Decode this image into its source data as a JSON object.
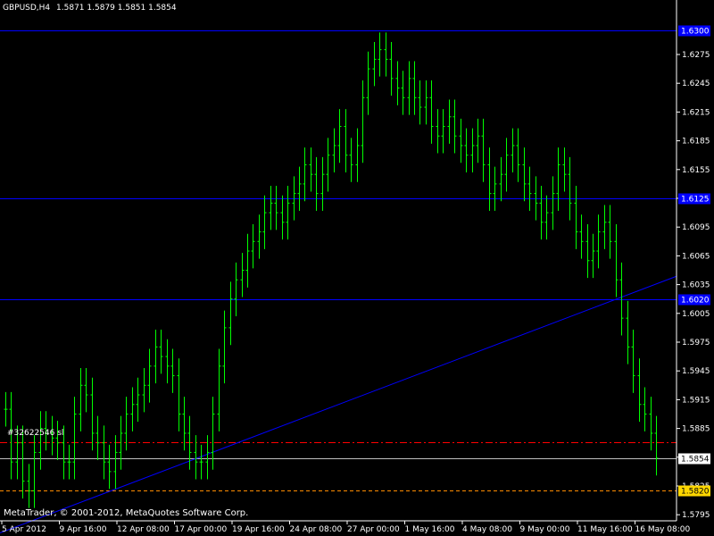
{
  "header": {
    "symbol_label": "GBPUSD,H4",
    "ohlc_label": "1.5871 1.5879 1.5851 1.5854"
  },
  "watermark": "MetaTrader, © 2001-2012, MetaQuotes Software Corp.",
  "order_label": "#32622546 sl",
  "colors": {
    "background": "#000000",
    "candle": "#00ff00",
    "hline": "#0000ff",
    "trendline": "#0000ff",
    "dashed_red": "#ff0000",
    "dashed_orange": "#ff8c00",
    "price_box_blue": "#0000ff",
    "price_box_current": "#ffffff",
    "price_box_orange": "#ffd700",
    "axis_text": "#ffffff"
  },
  "chart_data": {
    "type": "line",
    "symbol": "GBPUSD",
    "timeframe": "H4",
    "ylim": [
      1.579,
      1.632
    ],
    "y_ticks": [
      "1.6275",
      "1.6245",
      "1.6215",
      "1.6185",
      "1.6155",
      "1.6125",
      "1.6095",
      "1.6065",
      "1.6035",
      "1.6005",
      "1.5975",
      "1.5945",
      "1.5915",
      "1.5885",
      "1.5855",
      "1.5825",
      "1.5795"
    ],
    "x_ticks": [
      "5 Apr 2012",
      "9 Apr 16:00",
      "12 Apr 08:00",
      "17 Apr 00:00",
      "19 Apr 16:00",
      "24 Apr 08:00",
      "27 Apr 00:00",
      "1 May 16:00",
      "4 May 08:00",
      "9 May 00:00",
      "11 May 16:00",
      "16 May 08:00"
    ],
    "series": [
      {
        "values": [
          1.5905,
          1.585,
          1.587,
          1.583,
          1.582,
          1.586,
          1.5885,
          1.588,
          1.5875,
          1.587,
          1.585,
          1.585,
          1.59,
          1.593,
          1.592,
          1.588,
          1.587,
          1.585,
          1.584,
          1.586,
          1.588,
          1.59,
          1.591,
          1.592,
          1.593,
          1.595,
          1.597,
          1.596,
          1.595,
          1.594,
          1.59,
          1.588,
          1.586,
          1.585,
          1.585,
          1.586,
          1.59,
          1.595,
          1.599,
          1.602,
          1.604,
          1.605,
          1.607,
          1.608,
          1.609,
          1.611,
          1.612,
          1.611,
          1.61,
          1.612,
          1.613,
          1.614,
          1.616,
          1.615,
          1.613,
          1.615,
          1.617,
          1.618,
          1.62,
          1.617,
          1.616,
          1.618,
          1.623,
          1.626,
          1.627,
          1.628,
          1.627,
          1.625,
          1.624,
          1.623,
          1.625,
          1.623,
          1.622,
          1.623,
          1.62,
          1.619,
          1.62,
          1.621,
          1.619,
          1.618,
          1.617,
          1.618,
          1.619,
          1.616,
          1.613,
          1.614,
          1.615,
          1.617,
          1.618,
          1.616,
          1.614,
          1.613,
          1.612,
          1.61,
          1.611,
          1.613,
          1.616,
          1.615,
          1.612,
          1.609,
          1.608,
          1.606,
          1.607,
          1.609,
          1.61,
          1.608,
          1.604,
          1.6,
          1.597,
          1.594,
          1.591,
          1.59,
          1.588,
          1.5854
        ]
      }
    ],
    "horizontal_lines": [
      {
        "price": 1.63,
        "color": "#0000ff",
        "style": "solid",
        "label": "1.6300"
      },
      {
        "price": 1.6125,
        "color": "#0000ff",
        "style": "solid",
        "label": "1.6125"
      },
      {
        "price": 1.602,
        "color": "#0000ff",
        "style": "solid",
        "label": "1.6020"
      },
      {
        "price": 1.5871,
        "color": "#ff0000",
        "style": "dashdot"
      },
      {
        "price": 1.5854,
        "color": "#c0c0c0",
        "style": "solid",
        "label": "1.5854",
        "current": true
      },
      {
        "price": 1.582,
        "color": "#ff8c00",
        "style": "dashed",
        "label": "1.5820"
      }
    ],
    "trendline": {
      "from_price": 1.579,
      "to_price": 1.604,
      "color": "#0000ff"
    },
    "grid": false,
    "legend": "none"
  }
}
